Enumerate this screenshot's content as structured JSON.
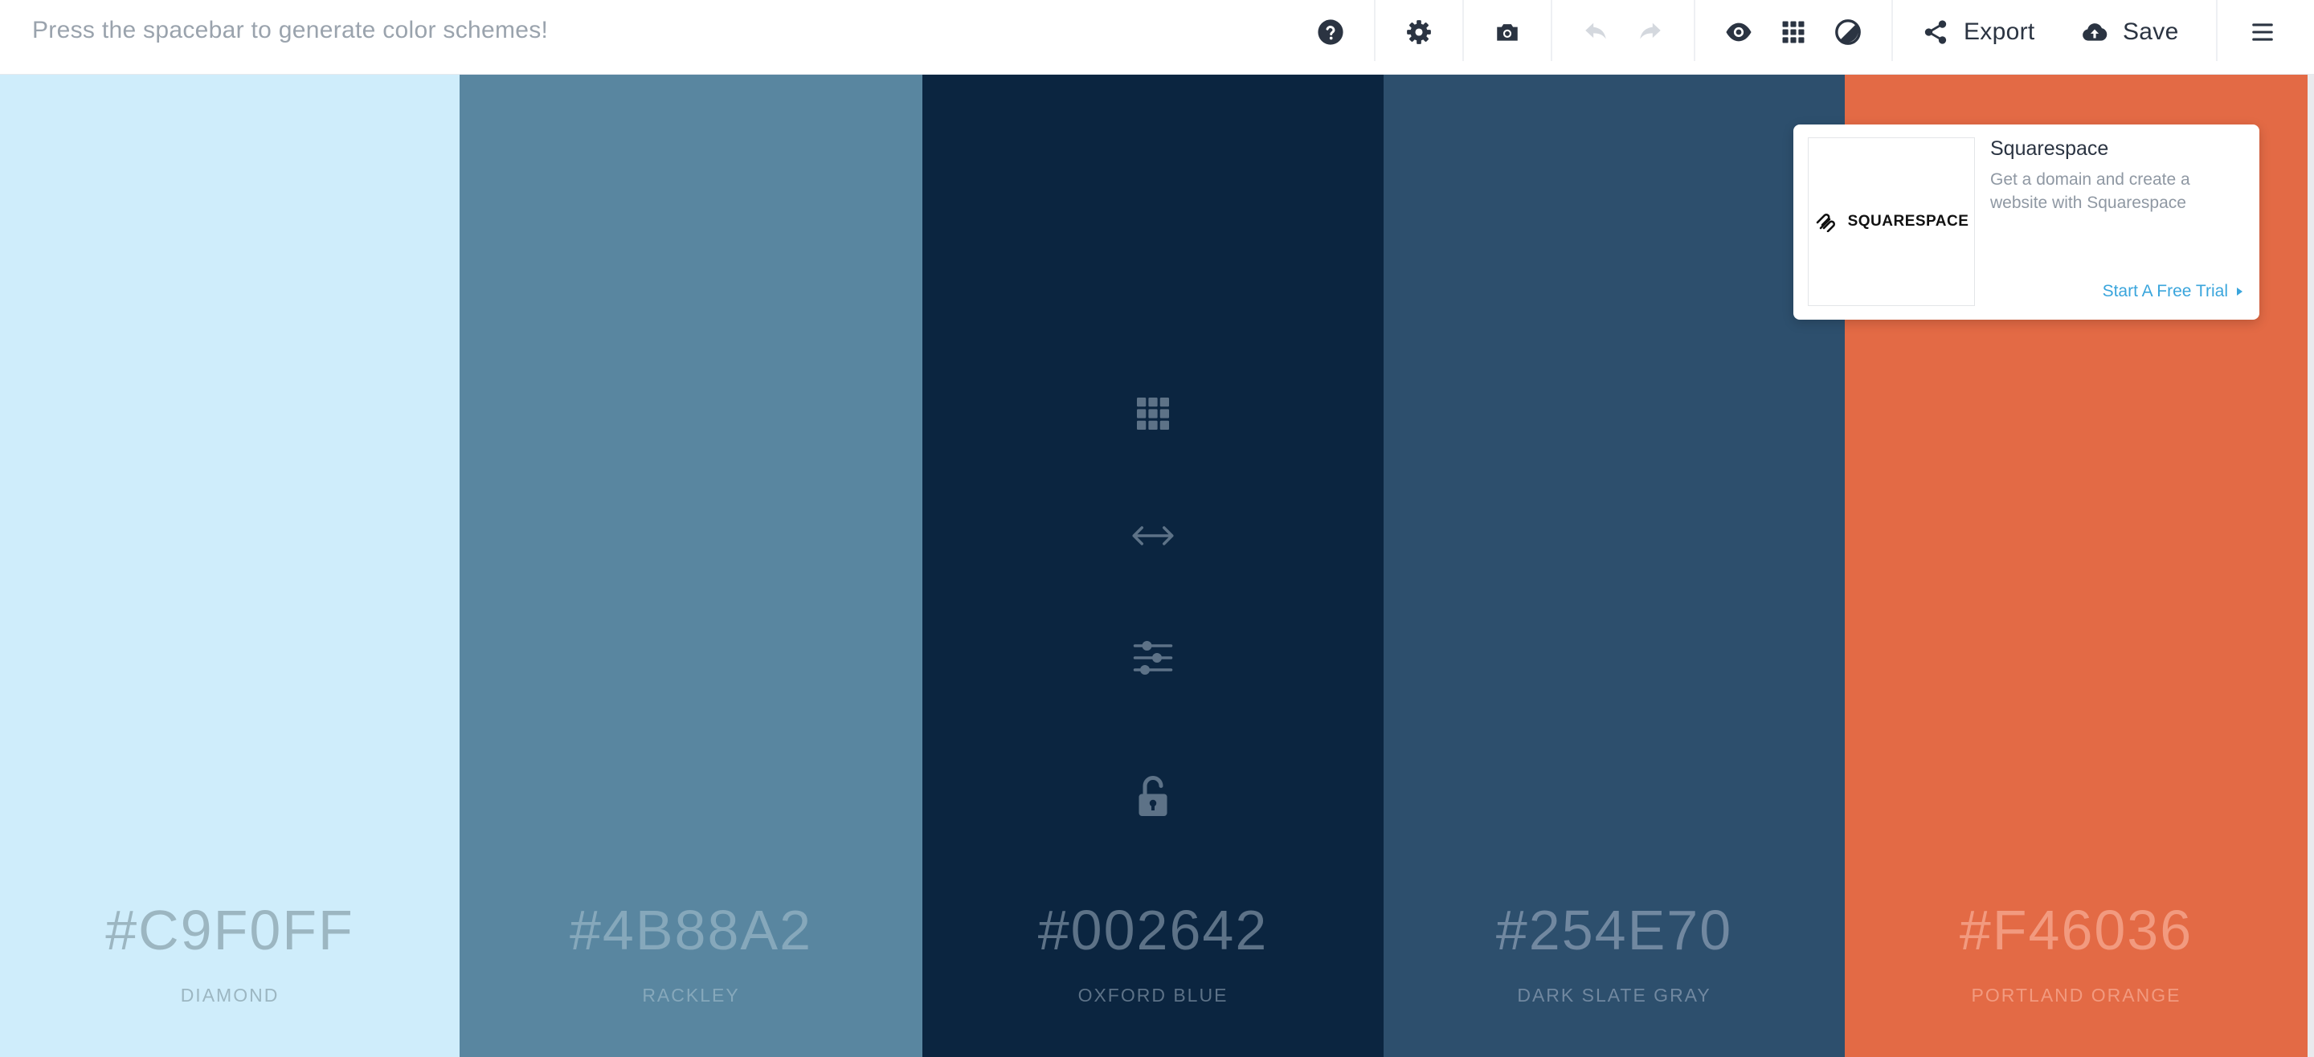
{
  "toolbar": {
    "hint": "Press the spacebar to generate color schemes!",
    "export_label": "Export",
    "save_label": "Save"
  },
  "palette": [
    {
      "hex": "#C9F0FF",
      "name": "DIAMOND",
      "bg": "#cfedfb",
      "text_color": "#9cb6c1"
    },
    {
      "hex": "#4B88A2",
      "name": "RACKLEY",
      "bg": "#5986a0",
      "text_color": "#86a8bb"
    },
    {
      "hex": "#002642",
      "name": "OXFORD BLUE",
      "bg": "#0b2540",
      "text_color": "#5d7287"
    },
    {
      "hex": "#254E70",
      "name": "DARK SLATE GRAY",
      "bg": "#2d4f6d",
      "text_color": "#7188a0"
    },
    {
      "hex": "#F46036",
      "name": "PORTLAND ORANGE",
      "bg": "#e36a45",
      "text_color": "#f29a7f"
    }
  ],
  "column_tools": [
    "grid-icon",
    "swap-arrows-icon",
    "sliders-icon",
    "unlock-icon"
  ],
  "ad": {
    "logo_text": "SQUARESPACE",
    "title": "Squarespace",
    "description": "Get a domain and create a website with Squarespace",
    "cta": "Start A Free Trial"
  },
  "colors": {
    "toolbar_text": "#2b3442",
    "hint_text": "#9aa3ad",
    "cta_blue": "#3aa5dc"
  }
}
